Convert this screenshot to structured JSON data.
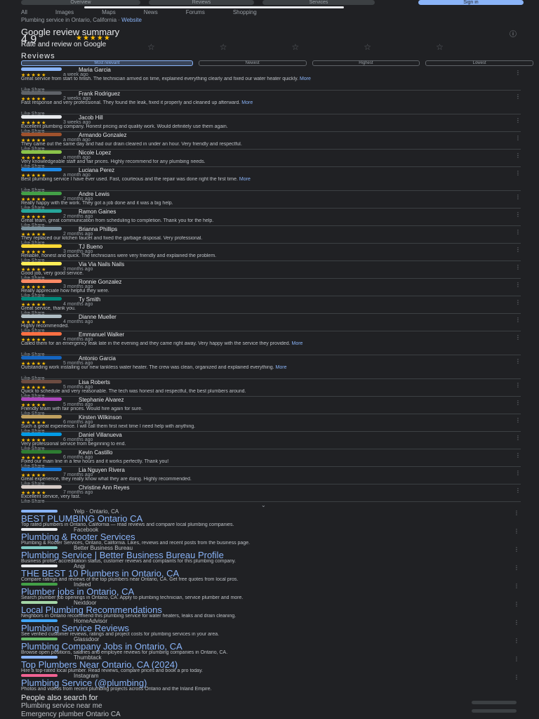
{
  "topbar": {
    "tabs": [
      "Overview",
      "Reviews",
      "Services"
    ],
    "sign_in": "Sign in"
  },
  "filters": [
    "All",
    "Images",
    "Maps",
    "News",
    "Forums",
    "Shopping"
  ],
  "business": {
    "line": "Plumbing service in Ontario, California",
    "link": "Website"
  },
  "summary": {
    "title": "Google review summary",
    "rating": "4.9",
    "stars": "★★★★★",
    "rate_title": "Rate and review on Google",
    "rate_stars": [
      "☆",
      "☆",
      "☆",
      "☆",
      "☆"
    ]
  },
  "reviews_heading": "Reviews",
  "sort_chips": [
    "Most relevant",
    "Newest",
    "Highest",
    "Lowest"
  ],
  "reviews": [
    {
      "name": "Maria Garcia",
      "meta": "a week ago",
      "text": "Great service from start to finish. The technician arrived on time, explained everything clearly and fixed our water heater quickly.",
      "color": "#8ab4f8"
    },
    {
      "name": "Frank Rodriguez",
      "meta": "2 weeks ago",
      "text": "Fast response and very professional. They found the leak, fixed it properly and cleaned up afterward.",
      "color": "#5f6368"
    },
    {
      "name": "Jacob Hill",
      "meta": "3 weeks ago",
      "text": "Excellent plumbing company. Honest pricing and quality work. Would definitely use them again.",
      "color": "#e8eaed"
    },
    {
      "name": "Armando Gonzalez",
      "meta": "a month ago",
      "text": "They came out the same day and had our drain cleared in under an hour. Very friendly and respectful.",
      "color": "#a0522d"
    },
    {
      "name": "Nicole Lopez",
      "meta": "a month ago",
      "text": "Very knowledgeable staff and fair prices. Highly recommend for any plumbing needs.",
      "color": "#8bc34a"
    },
    {
      "name": "Luciana Perez",
      "meta": "a month ago",
      "text": "Best plumbing service I have ever used. Fast, courteous and the repair was done right the first time.",
      "color": "#1e88e5"
    },
    {
      "name": "Andre Lewis",
      "meta": "2 months ago",
      "text": "Really happy with the work. They got a job done and it was a big help.",
      "color": "#43a047"
    },
    {
      "name": "Ramon Gaines",
      "meta": "2 months ago",
      "text": "Great team, great communication from scheduling to completion. Thank you for the help.",
      "color": "#26a69a"
    },
    {
      "name": "Brianna Phillips",
      "meta": "2 months ago",
      "text": "They replaced our kitchen faucet and fixed the garbage disposal. Very professional.",
      "color": "#78909c"
    },
    {
      "name": "TJ Bueno",
      "meta": "3 months ago",
      "text": "Reliable, honest and quick. The technicians were very friendly and explained the problem.",
      "color": "#fdd835"
    },
    {
      "name": "Via Via Nails Nails",
      "meta": "3 months ago",
      "text": "Good job, very good service.",
      "color": "#ffee58"
    },
    {
      "name": "Ronnie Gonzalez",
      "meta": "3 months ago",
      "text": "Really appreciate how helpful they were.",
      "color": "#ff8a65"
    },
    {
      "name": "Ty Smith",
      "meta": "4 months ago",
      "text": "Great service, thank you.",
      "color": "#00897b"
    },
    {
      "name": "Dianne Mueller",
      "meta": "4 months ago",
      "text": "Highly recommended.",
      "color": "#b0bec5"
    },
    {
      "name": "Emmanuel Walker",
      "meta": "4 months ago",
      "text": "Called them for an emergency leak late in the evening and they came right away. Very happy with the service they provided.",
      "color": "#ff7043"
    },
    {
      "name": "Antonio Garcia",
      "meta": "5 months ago",
      "text": "Outstanding work installing our new tankless water heater. The crew was clean, organized and explained everything.",
      "color": "#1565c0"
    },
    {
      "name": "Lisa Roberts",
      "meta": "5 months ago",
      "text": "Quick to schedule and very reasonable. The tech was honest and respectful, the best plumbers around.",
      "color": "#6d4c41"
    },
    {
      "name": "Stephanie Alvarez",
      "meta": "5 months ago",
      "text": "Friendly team with fair prices. Would hire again for sure.",
      "color": "#ab47bc"
    },
    {
      "name": "Kirsten Wilkinson",
      "meta": "6 months ago",
      "text": "Such a great experience. I will call them first next time I need help with anything.",
      "color": "#c0a060"
    },
    {
      "name": "Daniel Villanueva",
      "meta": "6 months ago",
      "text": "Very professional service from beginning to end.",
      "color": "#039be5"
    },
    {
      "name": "Kevin Castillo",
      "meta": "6 months ago",
      "text": "Fixed our main line in a few hours and it works perfectly. Thank you!",
      "color": "#2e7d32"
    },
    {
      "name": "Lia Nguyen Rivera",
      "meta": "7 months ago",
      "text": "Great experience, they really know what they are doing. Highly recommended.",
      "color": "#1976d2"
    },
    {
      "name": "Christine Ann Reyes",
      "meta": "7 months ago",
      "text": "Excellent service, very fast.",
      "color": "#d7ccc8"
    }
  ],
  "review_more": "More",
  "review_actions": "Like   Share",
  "results": [
    {
      "site": "Yelp · Ontario, CA",
      "title": "BEST PLUMBING Ontario CA",
      "snip": "Top rated plumbers in Ontario, California — read reviews and compare local plumbing companies.",
      "color": "#8ab4f8"
    },
    {
      "site": "Facebook",
      "title": "Plumbing & Rooter Services",
      "snip": "Plumbing & Rooter Services, Ontario, California. Likes, reviews and recent posts from the business page.",
      "color": "#e8eaed"
    },
    {
      "site": "Better Business Bureau",
      "title": "Plumbing Service | Better Business Bureau Profile",
      "snip": "Business profile, accreditation status, customer reviews and complaints for this plumbing company.",
      "color": "#80cbc4"
    },
    {
      "site": "Angi",
      "title": "THE BEST 10 Plumbers in Ontario, CA",
      "snip": "Compare ratings and reviews of the top plumbers near Ontario, CA. Get free quotes from local pros.",
      "color": "#e8eaed"
    },
    {
      "site": "Indeed",
      "title": "Plumber jobs in Ontario, CA",
      "snip": "Search plumber job openings in Ontario, CA. Apply to plumbing technician, service plumber and more.",
      "color": "#43a047"
    },
    {
      "site": "Nextdoor",
      "title": "Local Plumbing Recommendations",
      "snip": "Neighbors in Ontario recommend this plumbing service for water heaters, leaks and drain cleaning.",
      "color": "#a5d6a7"
    },
    {
      "site": "HomeAdvisor",
      "title": "Plumbing Service Reviews",
      "snip": "See verified customer reviews, ratings and project costs for plumbing services in your area.",
      "color": "#42a5f5"
    },
    {
      "site": "Glassdoor",
      "title": "Plumbing Company Jobs in Ontario, CA",
      "snip": "Browse open positions, salaries and employee reviews for plumbing companies in Ontario, CA.",
      "color": "#66bb6a"
    },
    {
      "site": "Thumbtack",
      "title": "Top Plumbers Near Ontario, CA (2024)",
      "snip": "Hire a top-rated local plumber. Read reviews, compare prices and book a pro today.",
      "color": "#8ab4f8"
    },
    {
      "site": "Instagram",
      "title": "Plumbing Service (@plumbing)",
      "snip": "Photos and videos from recent plumbing projects across Ontario and the Inland Empire.",
      "color": "#f06292"
    }
  ],
  "related": [
    "People also search for",
    "Plumbing service near me",
    "Emergency plumber Ontario CA"
  ]
}
